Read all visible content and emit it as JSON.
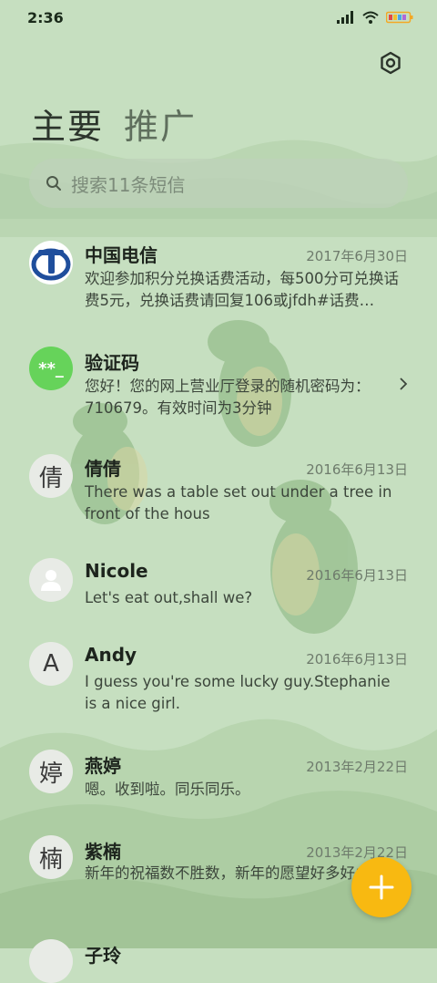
{
  "status_bar": {
    "time": "2:36"
  },
  "tabs": [
    {
      "label": "主要",
      "active": true
    },
    {
      "label": "推广",
      "active": false
    }
  ],
  "search": {
    "placeholder": "搜索11条短信"
  },
  "messages": [
    {
      "name": "中国电信",
      "date": "2017年6月30日",
      "avatar": "china-telecom-logo",
      "preview": "欢迎参加积分兑换话费活动，每500分可兑换话费5元，兑换话费请回复106或jfdh#话费…"
    },
    {
      "name": "验证码",
      "date": "",
      "avatar_text": "**_",
      "preview": "您好！您的网上营业厅登录的随机密码为：710679。有效时间为3分钟"
    },
    {
      "name": "倩倩",
      "date": "2016年6月13日",
      "avatar_text": "倩",
      "preview": "There was a table set out under a tree in front of the hous"
    },
    {
      "name": "Nicole",
      "date": "2016年6月13日",
      "avatar": "person-icon",
      "preview": "Let's eat out,shall we?"
    },
    {
      "name": "Andy",
      "date": "2016年6月13日",
      "avatar_text": "A",
      "preview": "I guess you're some lucky guy.Stephanie is a nice girl."
    },
    {
      "name": "燕婷",
      "date": "2013年2月22日",
      "avatar_text": "婷",
      "preview": "嗯。收到啦。同乐同乐。"
    },
    {
      "name": "紫楠",
      "date": "2013年2月22日",
      "avatar_text": "楠",
      "preview": "新年的祝福数不胜数，新年的愿望好多好多，新年的问候依旧美好，在这个温馨的时刻…"
    },
    {
      "name": "子玲",
      "date": "",
      "avatar_text": ""
    }
  ],
  "colors": {
    "fab": "#f8b911",
    "verify_avatar": "#66d35a",
    "telecom_blue": "#1f4e9c"
  }
}
